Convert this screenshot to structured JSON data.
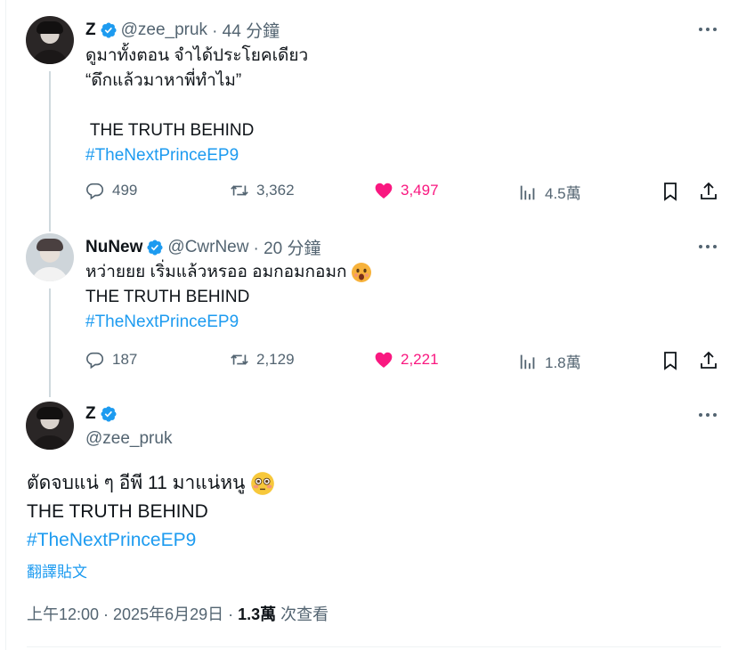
{
  "tweets": [
    {
      "name": "Z",
      "handle": "@zee_pruk",
      "time": "· 44 分鐘",
      "lines": [
        "ดูมาทั้งตอน จำได้ประโยคเดียว",
        "“ดึกแล้วมาหาพี่ทำไม”",
        "",
        " THE TRUTH BEHIND"
      ],
      "hashtag": "#TheNextPrinceEP9",
      "stats": {
        "replies": "499",
        "retweets": "3,362",
        "likes": "3,497",
        "views": "4.5萬"
      }
    },
    {
      "name": "NuNew",
      "handle": "@CwrNew",
      "time": "· 20 分鐘",
      "lines": [
        "หว่ายยย เริ่มแล้วหรออ อมกอมกอมก",
        "THE TRUTH BEHIND"
      ],
      "hashtag": "#TheNextPrinceEP9",
      "stats": {
        "replies": "187",
        "retweets": "2,129",
        "likes": "2,221",
        "views": "1.8萬"
      }
    }
  ],
  "main_tweet": {
    "name": "Z",
    "handle": "@zee_pruk",
    "lines": [
      "ตัดจบแน่ ๆ อีพี 11 มาแน่หนู",
      "THE TRUTH BEHIND"
    ],
    "hashtag": "#TheNextPrinceEP9",
    "translate_label": "翻譯貼文",
    "timestamp": "上午12:00 · 2025年6月29日",
    "sep": " · ",
    "views_count": "1.3萬",
    "views_label": " 次查看"
  },
  "colors": {
    "accent": "#1d9bf0",
    "like": "#f91880",
    "muted": "#536471",
    "text": "#0f1419"
  }
}
